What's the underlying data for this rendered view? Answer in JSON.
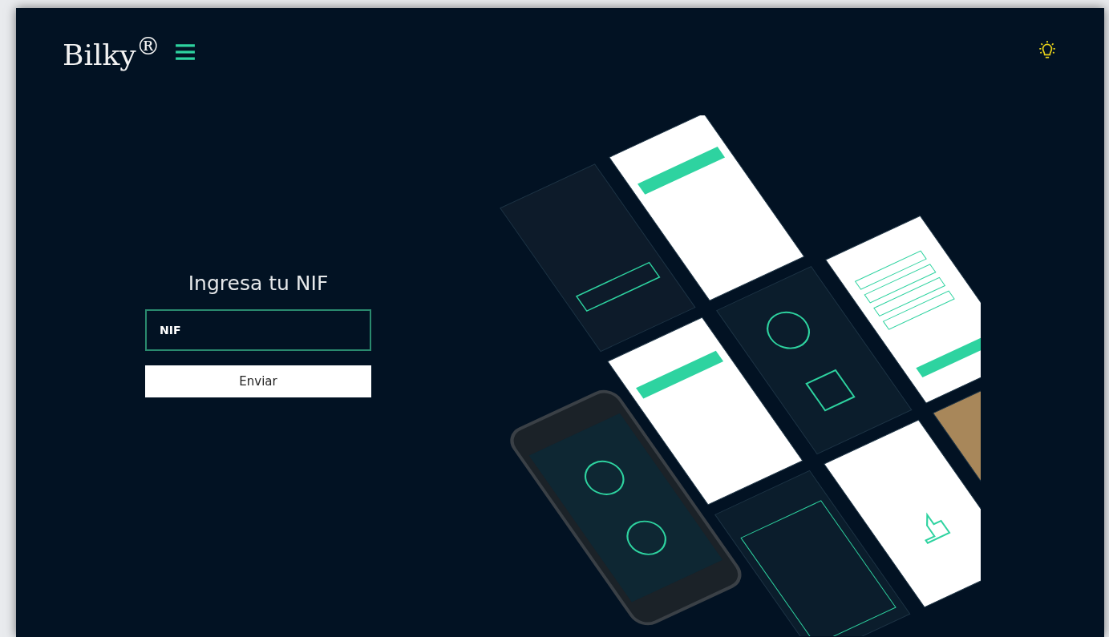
{
  "header": {
    "logo": "Bilky$^{®}$"
  },
  "form": {
    "title": "Ingresa tu NIF",
    "nif_field": {
      "placeholder": "NIF"
    },
    "submit_button": "Enviar"
  }
}
